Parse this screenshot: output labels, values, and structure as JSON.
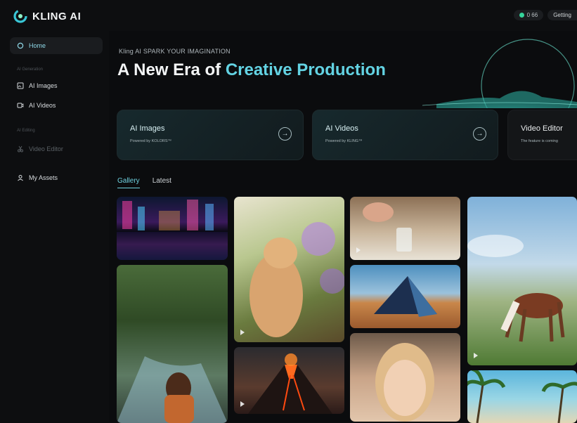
{
  "app": {
    "brand": "KLING AI"
  },
  "topbar": {
    "credits_value": "0 66",
    "getting_started": "Getting"
  },
  "sidebar": {
    "home": "Home",
    "section_generation": "AI Generation",
    "ai_images": "AI Images",
    "ai_videos": "AI Videos",
    "section_editing": "AI Editing",
    "video_editor": "Video Editor",
    "my_assets": "My Assets"
  },
  "hero": {
    "eyebrow": "Kling AI SPARK YOUR IMAGINATION",
    "headline_prefix": "A New Era of ",
    "headline_accent": "Creative Production"
  },
  "cards": [
    {
      "title": "AI Images",
      "subtitle": "Powered by KOLORS™"
    },
    {
      "title": "AI Videos",
      "subtitle": "Powered by KLING™"
    },
    {
      "title": "Video Editor",
      "subtitle": "The feature is coming"
    }
  ],
  "tabs": [
    {
      "label": "Gallery",
      "active": true
    },
    {
      "label": "Latest",
      "active": false
    }
  ],
  "gallery": {
    "items": [
      {
        "name": "city-night-reflection"
      },
      {
        "name": "cat-with-flowers"
      },
      {
        "name": "pouring-water-glass"
      },
      {
        "name": "horse-grazing-field"
      },
      {
        "name": "forest-river-hiker"
      },
      {
        "name": "glass-pyramid-desert"
      },
      {
        "name": "erupting-volcano"
      },
      {
        "name": "blonde-woman-portrait"
      },
      {
        "name": "palm-beach"
      }
    ]
  },
  "colors": {
    "accent": "#63d3e3",
    "background": "#0b0c0e",
    "card": "#17292d"
  }
}
